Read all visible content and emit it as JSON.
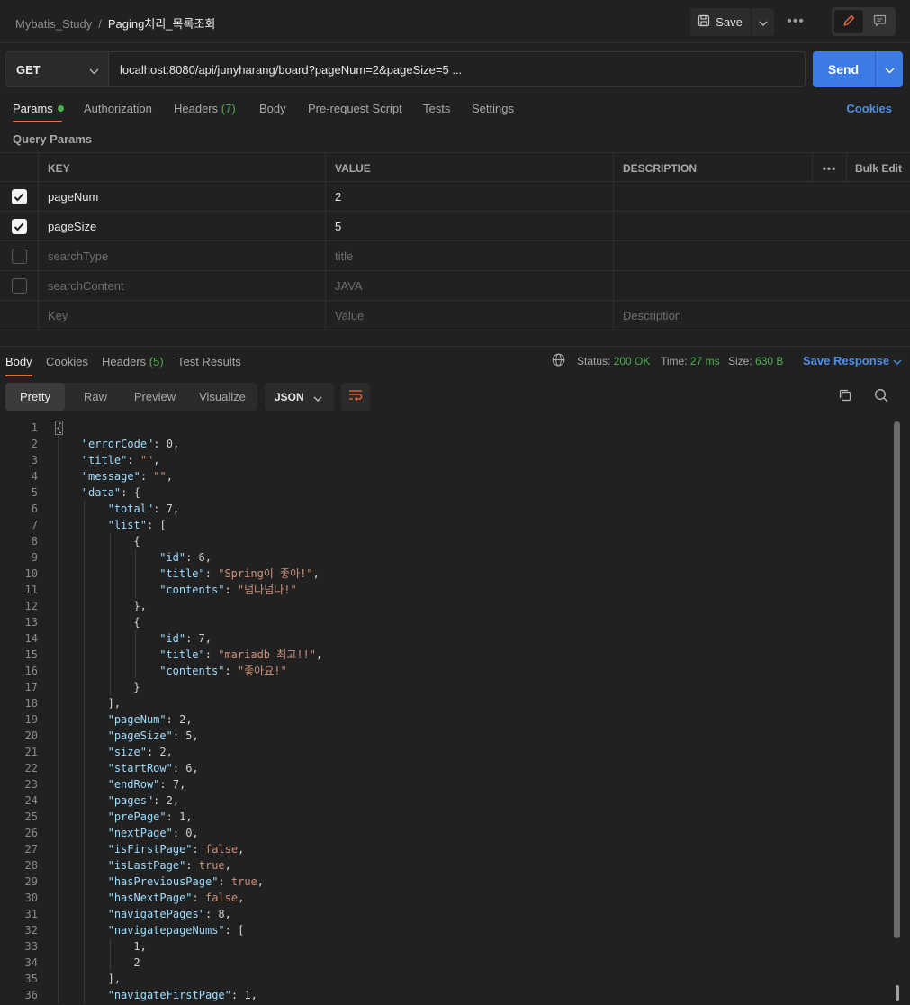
{
  "breadcrumb": {
    "collection": "Mybatis_Study",
    "separator": "/",
    "request": "Paging처리_목록조회"
  },
  "toolbar": {
    "save_label": "Save",
    "more": "•••"
  },
  "request": {
    "method": "GET",
    "url": "localhost:8080/api/junyharang/board?pageNum=2&pageSize=5 ...",
    "send_label": "Send"
  },
  "request_tabs": {
    "params": "Params",
    "authorization": "Authorization",
    "headers": "Headers",
    "headers_count": "(7)",
    "body": "Body",
    "pre_request": "Pre-request Script",
    "tests": "Tests",
    "settings": "Settings",
    "cookies": "Cookies"
  },
  "query_params": {
    "title": "Query Params",
    "columns": {
      "key": "KEY",
      "value": "VALUE",
      "description": "DESCRIPTION",
      "more": "•••",
      "bulk_edit": "Bulk Edit"
    },
    "rows": [
      {
        "key": "pageNum",
        "value": "2",
        "checked": true
      },
      {
        "key": "pageSize",
        "value": "5",
        "checked": true
      },
      {
        "key": "searchType",
        "value": "title",
        "checked": false
      },
      {
        "key": "searchContent",
        "value": "JAVA",
        "checked": false
      }
    ],
    "placeholders": {
      "key": "Key",
      "value": "Value",
      "description": "Description"
    }
  },
  "response_tabs": {
    "body": "Body",
    "cookies": "Cookies",
    "headers": "Headers",
    "headers_count": "(5)",
    "test_results": "Test Results"
  },
  "response_status": {
    "status_label": "Status:",
    "status_value": "200 OK",
    "time_label": "Time:",
    "time_value": "27 ms",
    "size_label": "Size:",
    "size_value": "630 B",
    "save_response": "Save Response"
  },
  "view_modes": {
    "pretty": "Pretty",
    "raw": "Raw",
    "preview": "Preview",
    "visualize": "Visualize",
    "format": "JSON"
  },
  "colors": {
    "accent_orange": "#f26b3a",
    "send_blue": "#3c7ae6",
    "link_blue": "#4d8ee8",
    "success_green": "#4cae4f"
  },
  "code_lines": [
    {
      "indent": 0,
      "parts": [
        [
          "p",
          "{"
        ]
      ]
    },
    {
      "indent": 1,
      "parts": [
        [
          "k",
          "\"errorCode\""
        ],
        [
          "p",
          ": "
        ],
        [
          "n",
          "0"
        ],
        [
          "p",
          ","
        ]
      ]
    },
    {
      "indent": 1,
      "parts": [
        [
          "k",
          "\"title\""
        ],
        [
          "p",
          ": "
        ],
        [
          "s",
          "\"\""
        ],
        [
          "p",
          ","
        ]
      ]
    },
    {
      "indent": 1,
      "parts": [
        [
          "k",
          "\"message\""
        ],
        [
          "p",
          ": "
        ],
        [
          "s",
          "\"\""
        ],
        [
          "p",
          ","
        ]
      ]
    },
    {
      "indent": 1,
      "parts": [
        [
          "k",
          "\"data\""
        ],
        [
          "p",
          ": {"
        ]
      ]
    },
    {
      "indent": 2,
      "parts": [
        [
          "k",
          "\"total\""
        ],
        [
          "p",
          ": "
        ],
        [
          "n",
          "7"
        ],
        [
          "p",
          ","
        ]
      ]
    },
    {
      "indent": 2,
      "parts": [
        [
          "k",
          "\"list\""
        ],
        [
          "p",
          ": ["
        ]
      ]
    },
    {
      "indent": 3,
      "parts": [
        [
          "p",
          "{"
        ]
      ]
    },
    {
      "indent": 4,
      "parts": [
        [
          "k",
          "\"id\""
        ],
        [
          "p",
          ": "
        ],
        [
          "n",
          "6"
        ],
        [
          "p",
          ","
        ]
      ]
    },
    {
      "indent": 4,
      "parts": [
        [
          "k",
          "\"title\""
        ],
        [
          "p",
          ": "
        ],
        [
          "s",
          "\"Spring이 좋아!\""
        ],
        [
          "p",
          ","
        ]
      ]
    },
    {
      "indent": 4,
      "parts": [
        [
          "k",
          "\"contents\""
        ],
        [
          "p",
          ": "
        ],
        [
          "s",
          "\"넘나넘나!\""
        ]
      ]
    },
    {
      "indent": 3,
      "parts": [
        [
          "p",
          "},"
        ]
      ]
    },
    {
      "indent": 3,
      "parts": [
        [
          "p",
          "{"
        ]
      ]
    },
    {
      "indent": 4,
      "parts": [
        [
          "k",
          "\"id\""
        ],
        [
          "p",
          ": "
        ],
        [
          "n",
          "7"
        ],
        [
          "p",
          ","
        ]
      ]
    },
    {
      "indent": 4,
      "parts": [
        [
          "k",
          "\"title\""
        ],
        [
          "p",
          ": "
        ],
        [
          "s",
          "\"mariadb 최고!!\""
        ],
        [
          "p",
          ","
        ]
      ]
    },
    {
      "indent": 4,
      "parts": [
        [
          "k",
          "\"contents\""
        ],
        [
          "p",
          ": "
        ],
        [
          "s",
          "\"좋아요!\""
        ]
      ]
    },
    {
      "indent": 3,
      "parts": [
        [
          "p",
          "}"
        ]
      ]
    },
    {
      "indent": 2,
      "parts": [
        [
          "p",
          "],"
        ]
      ]
    },
    {
      "indent": 2,
      "parts": [
        [
          "k",
          "\"pageNum\""
        ],
        [
          "p",
          ": "
        ],
        [
          "n",
          "2"
        ],
        [
          "p",
          ","
        ]
      ]
    },
    {
      "indent": 2,
      "parts": [
        [
          "k",
          "\"pageSize\""
        ],
        [
          "p",
          ": "
        ],
        [
          "n",
          "5"
        ],
        [
          "p",
          ","
        ]
      ]
    },
    {
      "indent": 2,
      "parts": [
        [
          "k",
          "\"size\""
        ],
        [
          "p",
          ": "
        ],
        [
          "n",
          "2"
        ],
        [
          "p",
          ","
        ]
      ]
    },
    {
      "indent": 2,
      "parts": [
        [
          "k",
          "\"startRow\""
        ],
        [
          "p",
          ": "
        ],
        [
          "n",
          "6"
        ],
        [
          "p",
          ","
        ]
      ]
    },
    {
      "indent": 2,
      "parts": [
        [
          "k",
          "\"endRow\""
        ],
        [
          "p",
          ": "
        ],
        [
          "n",
          "7"
        ],
        [
          "p",
          ","
        ]
      ]
    },
    {
      "indent": 2,
      "parts": [
        [
          "k",
          "\"pages\""
        ],
        [
          "p",
          ": "
        ],
        [
          "n",
          "2"
        ],
        [
          "p",
          ","
        ]
      ]
    },
    {
      "indent": 2,
      "parts": [
        [
          "k",
          "\"prePage\""
        ],
        [
          "p",
          ": "
        ],
        [
          "n",
          "1"
        ],
        [
          "p",
          ","
        ]
      ]
    },
    {
      "indent": 2,
      "parts": [
        [
          "k",
          "\"nextPage\""
        ],
        [
          "p",
          ": "
        ],
        [
          "n",
          "0"
        ],
        [
          "p",
          ","
        ]
      ]
    },
    {
      "indent": 2,
      "parts": [
        [
          "k",
          "\"isFirstPage\""
        ],
        [
          "p",
          ": "
        ],
        [
          "b",
          "false"
        ],
        [
          "p",
          ","
        ]
      ]
    },
    {
      "indent": 2,
      "parts": [
        [
          "k",
          "\"isLastPage\""
        ],
        [
          "p",
          ": "
        ],
        [
          "b",
          "true"
        ],
        [
          "p",
          ","
        ]
      ]
    },
    {
      "indent": 2,
      "parts": [
        [
          "k",
          "\"hasPreviousPage\""
        ],
        [
          "p",
          ": "
        ],
        [
          "b",
          "true"
        ],
        [
          "p",
          ","
        ]
      ]
    },
    {
      "indent": 2,
      "parts": [
        [
          "k",
          "\"hasNextPage\""
        ],
        [
          "p",
          ": "
        ],
        [
          "b",
          "false"
        ],
        [
          "p",
          ","
        ]
      ]
    },
    {
      "indent": 2,
      "parts": [
        [
          "k",
          "\"navigatePages\""
        ],
        [
          "p",
          ": "
        ],
        [
          "n",
          "8"
        ],
        [
          "p",
          ","
        ]
      ]
    },
    {
      "indent": 2,
      "parts": [
        [
          "k",
          "\"navigatepageNums\""
        ],
        [
          "p",
          ": ["
        ]
      ]
    },
    {
      "indent": 3,
      "parts": [
        [
          "n",
          "1"
        ],
        [
          "p",
          ","
        ]
      ]
    },
    {
      "indent": 3,
      "parts": [
        [
          "n",
          "2"
        ]
      ]
    },
    {
      "indent": 2,
      "parts": [
        [
          "p",
          "],"
        ]
      ]
    },
    {
      "indent": 2,
      "parts": [
        [
          "k",
          "\"navigateFirstPage\""
        ],
        [
          "p",
          ": "
        ],
        [
          "n",
          "1"
        ],
        [
          "p",
          ","
        ]
      ]
    }
  ]
}
